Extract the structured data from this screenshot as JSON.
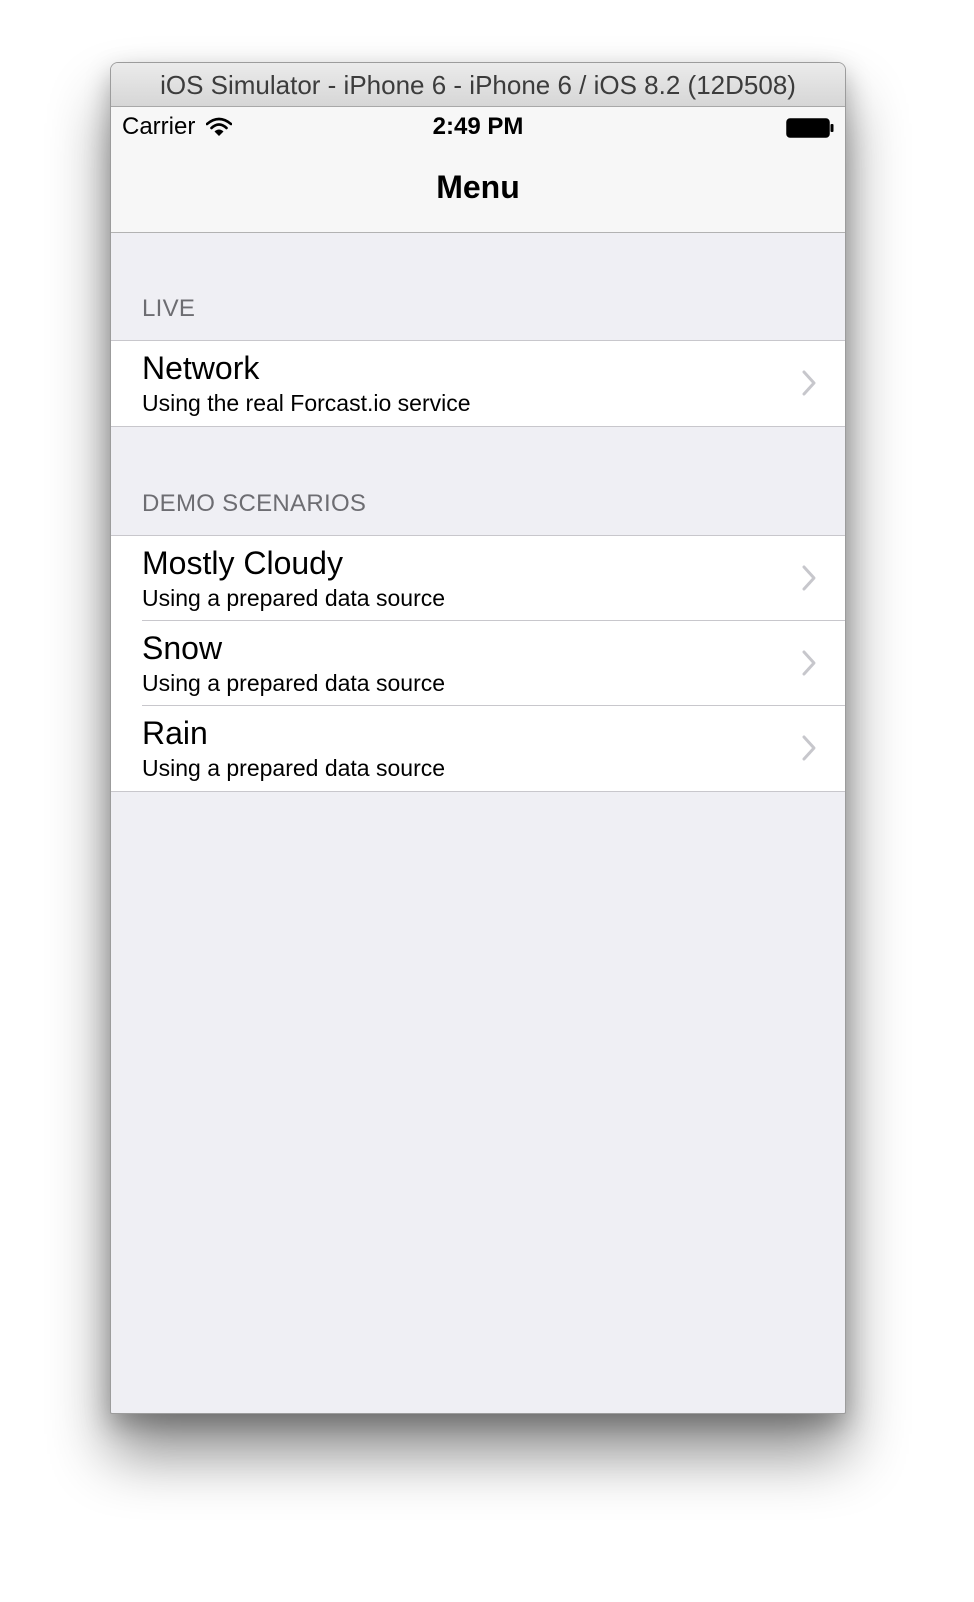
{
  "window": {
    "title": "iOS Simulator - iPhone 6 - iPhone 6 / iOS 8.2 (12D508)"
  },
  "status_bar": {
    "carrier": "Carrier",
    "time": "2:49 PM",
    "icons": [
      "wifi-icon",
      "battery-icon"
    ]
  },
  "nav_bar": {
    "title": "Menu"
  },
  "sections": [
    {
      "header": "LIVE",
      "rows": [
        {
          "title": "Network",
          "subtitle": "Using the real Forcast.io service"
        }
      ]
    },
    {
      "header": "DEMO SCENARIOS",
      "rows": [
        {
          "title": "Mostly Cloudy",
          "subtitle": "Using a prepared data source"
        },
        {
          "title": "Snow",
          "subtitle": "Using a prepared data source"
        },
        {
          "title": "Rain",
          "subtitle": "Using a prepared data source"
        }
      ]
    }
  ],
  "colors": {
    "background": "#efeff4",
    "separator": "#c8c7cc",
    "section_header_text": "#6d6d72",
    "chevron": "#c7c7cc"
  }
}
